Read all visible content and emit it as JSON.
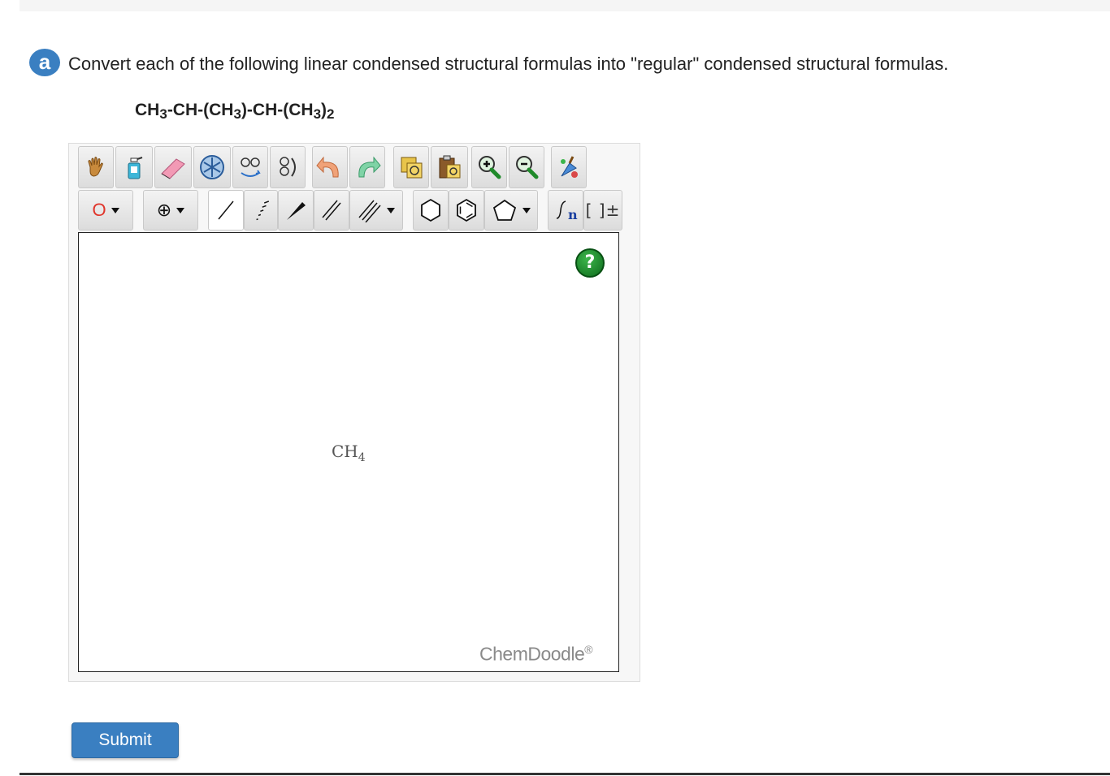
{
  "question": {
    "badge": "a",
    "text": "Convert each of the following linear condensed structural formulas into \"regular\" condensed structural formulas."
  },
  "formula": {
    "parts": [
      "CH",
      "3",
      "-CH-(CH",
      "3",
      ")-CH-(CH",
      "3",
      ")",
      "2"
    ]
  },
  "editor": {
    "toolbar_row1": [
      "hand-icon",
      "spray-bottle-icon",
      "eraser-icon",
      "snowflake-icon",
      "flip-icon",
      "rotate-icon",
      "undo-icon",
      "redo-icon",
      "copy-icon",
      "paste-icon",
      "zoom-in-icon",
      "zoom-out-icon",
      "clean-icon"
    ],
    "element_label": "O",
    "charge_label": "⊕",
    "bracket_label": "[ ]±",
    "repeat_label": "n",
    "help_label": "?",
    "canvas_molecule": [
      "CH",
      "4"
    ],
    "watermark": "ChemDoodle",
    "watermark_mark": "®"
  },
  "submit_label": "Submit",
  "colors": {
    "accent": "#3a7fc1",
    "help_green": "#1a8a2a",
    "element_red": "#e0352b"
  }
}
